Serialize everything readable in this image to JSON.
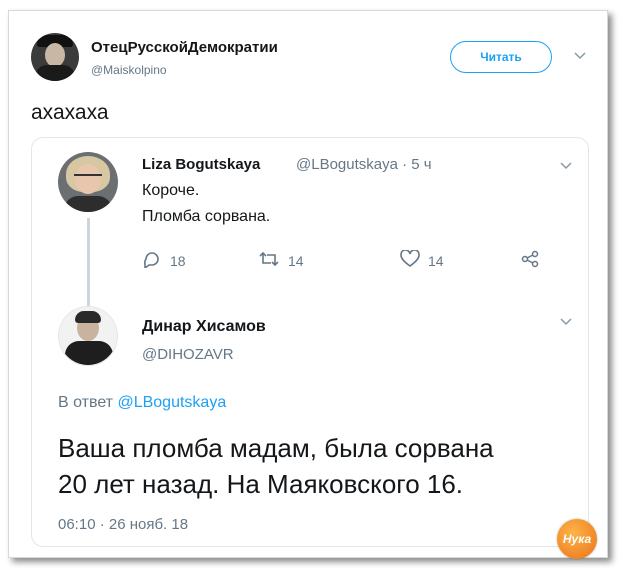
{
  "outer_tweet": {
    "author_name": "ОтецРусскойДемократии",
    "author_handle": "@Maiskolpino",
    "follow_label": "Читать",
    "text": "ахахаха"
  },
  "quoted_tweet": {
    "author_name": "Liza Bogutskaya",
    "meta": "@LBogutskaya · 5 ч",
    "lines": [
      "Короче.",
      "Пломба сорвана."
    ],
    "replies": "18",
    "retweets": "14",
    "likes": "14"
  },
  "reply_tweet": {
    "author_name": "Динар Хисамов",
    "author_handle": "@DIHOZAVR",
    "reply_prefix": "В ответ",
    "reply_mention": "@LBogutskaya",
    "lines": [
      "Ваша пломба мадам, была сорвана",
      "20 лет назад. На Маяковского 16."
    ],
    "timestamp": "06:10 · 26 нояб. 18"
  },
  "watermark": {
    "label": "Нука"
  },
  "colors": {
    "accent": "#1da1f2",
    "muted": "#657786",
    "text": "#14171a"
  },
  "icons": [
    "chevron-down-icon",
    "reply-icon",
    "retweet-icon",
    "like-icon",
    "share-icon"
  ]
}
